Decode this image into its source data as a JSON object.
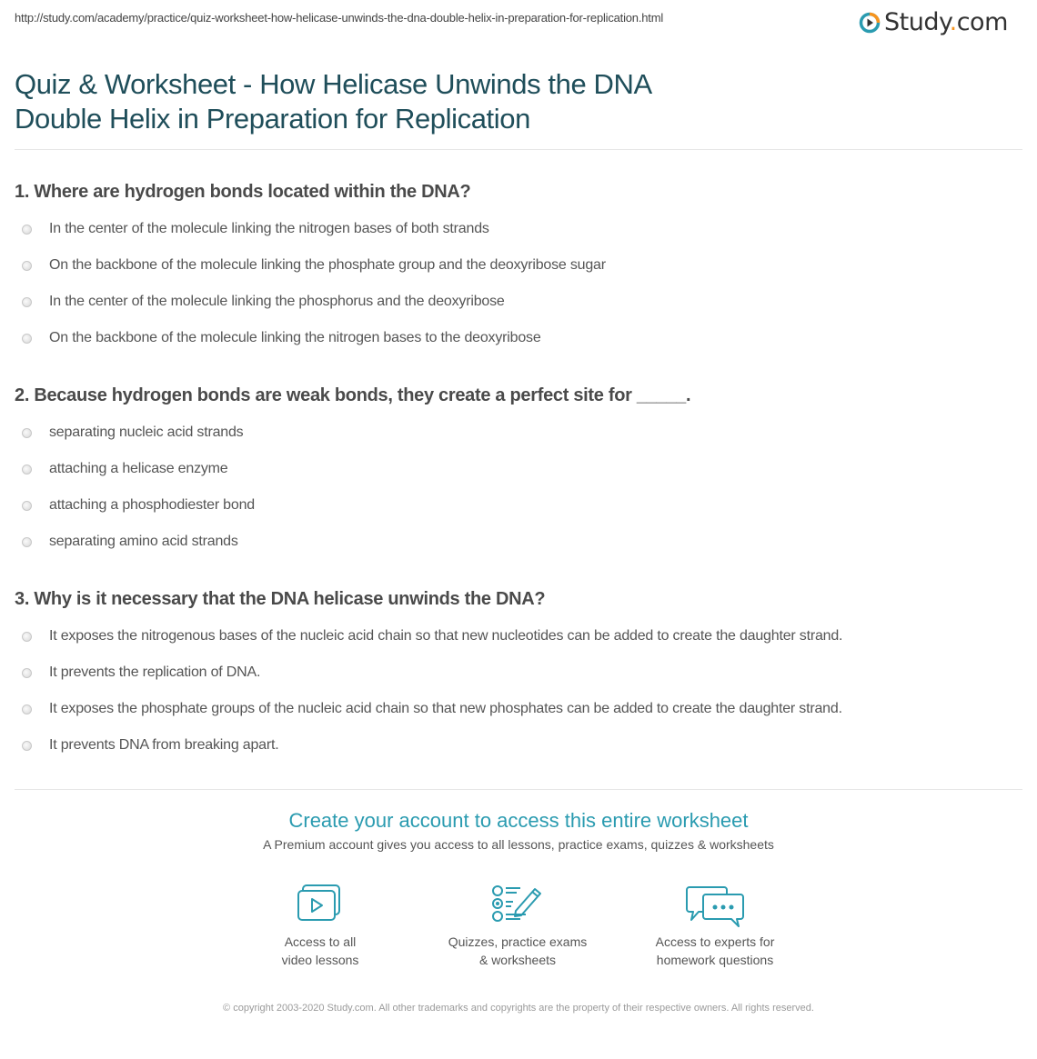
{
  "url": "http://study.com/academy/practice/quiz-worksheet-how-helicase-unwinds-the-dna-double-helix-in-preparation-for-replication.html",
  "logo": {
    "icon": "play-circle-icon",
    "text_main": "Study",
    "text_dot": ".",
    "text_tld": "com",
    "accent_color": "#f7941d",
    "ring_color": "#2a9bb0"
  },
  "page_title": "Quiz & Worksheet - How Helicase Unwinds the DNA Double Helix in Preparation for Replication",
  "questions": [
    {
      "text": "1. Where are hydrogen bonds located within the DNA?",
      "options": [
        "In the center of the molecule linking the nitrogen bases of both strands",
        "On the backbone of the molecule linking the phosphate group and the deoxyribose sugar",
        "In the center of the molecule linking the phosphorus and the deoxyribose",
        "On the backbone of the molecule linking the nitrogen bases to the deoxyribose"
      ]
    },
    {
      "text": "2. Because hydrogen bonds are weak bonds, they create a perfect site for _____.",
      "options": [
        "separating nucleic acid strands",
        "attaching a helicase enzyme",
        "attaching a phosphodiester bond",
        "separating amino acid strands"
      ]
    },
    {
      "text": "3. Why is it necessary that the DNA helicase unwinds the DNA?",
      "options": [
        "It exposes the nitrogenous bases of the nucleic acid chain so that new nucleotides can be added to create the daughter strand.",
        "It prevents the replication of DNA.",
        "It exposes the phosphate groups of the nucleic acid chain so that new phosphates can be added to create the daughter strand.",
        "It prevents DNA from breaking apart."
      ]
    }
  ],
  "cta": {
    "title": "Create your account to access this entire worksheet",
    "subtitle": "A Premium account gives you access to all lessons, practice exams, quizzes & worksheets",
    "accent_color": "#2a9bb0",
    "features": [
      {
        "icon": "video-lessons-icon",
        "line1": "Access to all",
        "line2": "video lessons"
      },
      {
        "icon": "quiz-checklist-icon",
        "line1": "Quizzes, practice exams",
        "line2": "& worksheets"
      },
      {
        "icon": "chat-bubbles-icon",
        "line1": "Access to experts for",
        "line2": "homework questions"
      }
    ]
  },
  "copyright": "© copyright 2003-2020 Study.com. All other trademarks and copyrights are the property of their respective owners. All rights reserved."
}
